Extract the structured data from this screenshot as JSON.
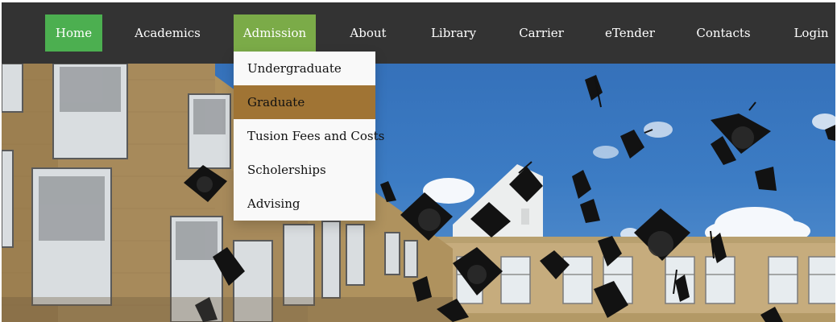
{
  "nav": {
    "items": [
      {
        "label": "Home",
        "state": "active"
      },
      {
        "label": "Academics",
        "state": "normal"
      },
      {
        "label": "Admission",
        "state": "open"
      },
      {
        "label": "About",
        "state": "normal"
      },
      {
        "label": "Library",
        "state": "normal"
      },
      {
        "label": "Carrier",
        "state": "normal"
      },
      {
        "label": "eTender",
        "state": "normal"
      },
      {
        "label": "Contacts",
        "state": "normal"
      },
      {
        "label": "Login",
        "state": "normal"
      }
    ]
  },
  "admission_dropdown": {
    "items": [
      {
        "label": "Undergraduate"
      },
      {
        "label": "Graduate",
        "state": "hover"
      },
      {
        "label": "Tusion Fees and Costs"
      },
      {
        "label": "Scholerships"
      },
      {
        "label": "Advising"
      }
    ]
  },
  "hero": {
    "image": "graduation-caps-thrown-in-air"
  },
  "colors": {
    "navbar_bg": "#333333",
    "home_active": "#4caf50",
    "admission_open": "#7bab48",
    "dropdown_bg": "#f9f9f9",
    "dropdown_hover": "#a07434",
    "nav_text": "#ffffff"
  }
}
